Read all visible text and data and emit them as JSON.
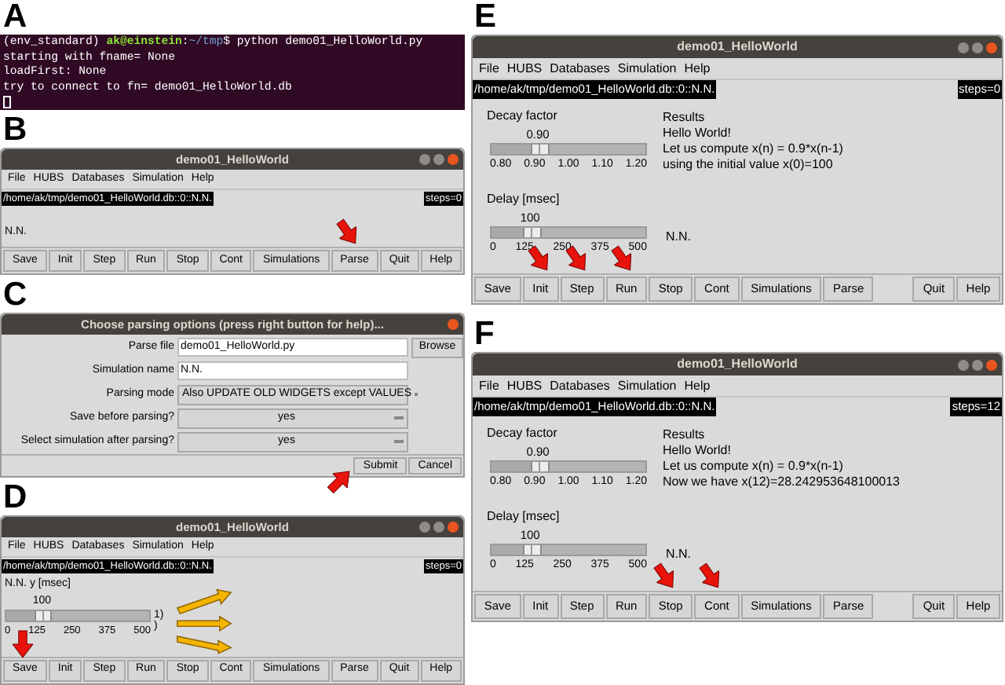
{
  "left_column": [
    {
      "letter": "A",
      "kind": "terminal",
      "prompt": [
        {
          "text": "(env_standard) ",
          "color": "#ffffff"
        },
        {
          "text": "ak@einstein",
          "color": "#8ae234"
        },
        {
          "text": ":",
          "color": "#ffffff"
        },
        {
          "text": "~/tmp",
          "color": "#729fcf"
        },
        {
          "text": "$ python demo01_HelloWorld.py",
          "color": "#ffffff"
        }
      ],
      "lines": [
        "starting with fname= None",
        "loadFirst: None",
        "try to connect to fn= demo01_HelloWorld.db"
      ]
    },
    {
      "letter": "B",
      "kind": "window",
      "title": "demo01_HelloWorld",
      "menu": [
        "File",
        "HUBS",
        "Databases",
        "Simulation",
        "Help"
      ],
      "path": "/home/ak/tmp/demo01_HelloWorld.db::0::N.N.",
      "steps": "steps=0",
      "body": {
        "kind": "text",
        "text": "N.N."
      },
      "buttons": [
        {
          "label": "Save",
          "pointed": false
        },
        {
          "label": "Init",
          "pointed": false
        },
        {
          "label": "Step",
          "pointed": false
        },
        {
          "label": "Run",
          "pointed": false
        },
        {
          "label": "Stop",
          "pointed": false
        },
        {
          "label": "Cont",
          "pointed": false
        },
        {
          "label": "Simulations",
          "pointed": false
        },
        {
          "label": "Parse",
          "pointed": true
        },
        {
          "label": "Quit",
          "pointed": false
        },
        {
          "label": "Help",
          "pointed": false
        }
      ]
    },
    {
      "letter": "C",
      "kind": "dialog",
      "title": "Choose parsing options (press right button for help)...",
      "rows": [
        {
          "label": "Parse file",
          "kind": "entry",
          "value": "demo01_HelloWorld.py",
          "side_button": "Browse"
        },
        {
          "label": "Simulation name",
          "kind": "entry",
          "value": "N.N."
        },
        {
          "label": "Parsing mode",
          "kind": "menu",
          "value": "Also UPDATE OLD WIDGETS except VALUES"
        },
        {
          "label": "Save before parsing?",
          "kind": "menu",
          "value": "yes"
        },
        {
          "label": "Select simulation after parsing?",
          "kind": "menu",
          "value": "yes"
        }
      ],
      "buttons": [
        {
          "label": "Submit",
          "pointed": true
        },
        {
          "label": "Cancel",
          "pointed": false
        }
      ]
    },
    {
      "letter": "D",
      "kind": "window",
      "title": "demo01_HelloWorld",
      "menu": [
        "File",
        "HUBS",
        "Databases",
        "Simulation",
        "Help"
      ],
      "path": "/home/ak/tmp/demo01_HelloWorld.db::0::N.N.",
      "steps": "steps=0",
      "body": {
        "kind": "single_slider",
        "caption": "N.N. y [msec]",
        "value": "100",
        "level": 0.2,
        "ticks": [
          "0",
          "125",
          "250",
          "375",
          "500"
        ],
        "side_texts": [
          "1)",
          ")"
        ]
      },
      "buttons": [
        {
          "label": "Save",
          "pointed": true
        },
        {
          "label": "Init",
          "pointed": false
        },
        {
          "label": "Step",
          "pointed": false
        },
        {
          "label": "Run",
          "pointed": false
        },
        {
          "label": "Stop",
          "pointed": false
        },
        {
          "label": "Cont",
          "pointed": false
        },
        {
          "label": "Simulations",
          "pointed": false
        },
        {
          "label": "Parse",
          "pointed": false
        },
        {
          "label": "Quit",
          "pointed": false
        },
        {
          "label": "Help",
          "pointed": false
        }
      ]
    }
  ],
  "right_column": [
    {
      "letter": "E",
      "kind": "window",
      "title": "demo01_HelloWorld",
      "menu": [
        "File",
        "HUBS",
        "Databases",
        "Simulation",
        "Help"
      ],
      "path": "/home/ak/tmp/demo01_HelloWorld.db::0::N.N.",
      "steps": "steps=0",
      "body": {
        "kind": "simulation",
        "sliders": [
          {
            "label": "Decay factor",
            "value": "0.90",
            "level": 0.25,
            "ticks": [
              "0.80",
              "0.90",
              "1.00",
              "1.10",
              "1.20"
            ]
          },
          {
            "label": "Delay [msec]",
            "value": "100",
            "level": 0.2,
            "ticks": [
              "0",
              "125",
              "250",
              "375",
              "500"
            ]
          }
        ],
        "results_title": "Results",
        "results": [
          "Hello World!",
          "Let us compute x(n) = 0.9*x(n-1)",
          "using the initial value x(0)=100"
        ],
        "footer_text": "N.N."
      },
      "buttons": [
        {
          "label": "Save",
          "gap_before": false,
          "pointed": false
        },
        {
          "label": "Init",
          "gap_before": false,
          "pointed": true
        },
        {
          "label": "Step",
          "gap_before": false,
          "pointed": true
        },
        {
          "label": "Run",
          "gap_before": false,
          "pointed": true
        },
        {
          "label": "Stop",
          "gap_before": false,
          "pointed": false
        },
        {
          "label": "Cont",
          "gap_before": false,
          "pointed": false
        },
        {
          "label": "Simulations",
          "gap_before": false,
          "pointed": false
        },
        {
          "label": "Parse",
          "gap_before": false,
          "pointed": false
        },
        {
          "label": "Quit",
          "gap_before": true,
          "pointed": false
        },
        {
          "label": "Help",
          "gap_before": false,
          "pointed": false
        }
      ]
    },
    {
      "letter": "F",
      "kind": "window",
      "title": "demo01_HelloWorld",
      "menu": [
        "File",
        "HUBS",
        "Databases",
        "Simulation",
        "Help"
      ],
      "path": "/home/ak/tmp/demo01_HelloWorld.db::0::N.N.",
      "steps": "steps=12",
      "body": {
        "kind": "simulation",
        "sliders": [
          {
            "label": "Decay factor",
            "value": "0.90",
            "level": 0.25,
            "ticks": [
              "0.80",
              "0.90",
              "1.00",
              "1.10",
              "1.20"
            ]
          },
          {
            "label": "Delay [msec]",
            "value": "100",
            "level": 0.2,
            "ticks": [
              "0",
              "125",
              "250",
              "375",
              "500"
            ]
          }
        ],
        "results_title": "Results",
        "results": [
          "Hello World!",
          "Let us compute x(n) = 0.9*x(n-1)",
          "Now we have x(12)=28.242953648100013"
        ],
        "footer_text": "N.N."
      },
      "buttons": [
        {
          "label": "Save",
          "gap_before": false,
          "pointed": false
        },
        {
          "label": "Init",
          "gap_before": false,
          "pointed": false
        },
        {
          "label": "Step",
          "gap_before": false,
          "pointed": false
        },
        {
          "label": "Run",
          "gap_before": false,
          "pointed": false
        },
        {
          "label": "Stop",
          "gap_before": false,
          "pointed": true
        },
        {
          "label": "Cont",
          "gap_before": false,
          "pointed": true
        },
        {
          "label": "Simulations",
          "gap_before": false,
          "pointed": false
        },
        {
          "label": "Parse",
          "gap_before": false,
          "pointed": false
        },
        {
          "label": "Quit",
          "gap_before": true,
          "pointed": false
        },
        {
          "label": "Help",
          "gap_before": false,
          "pointed": false
        }
      ]
    }
  ]
}
